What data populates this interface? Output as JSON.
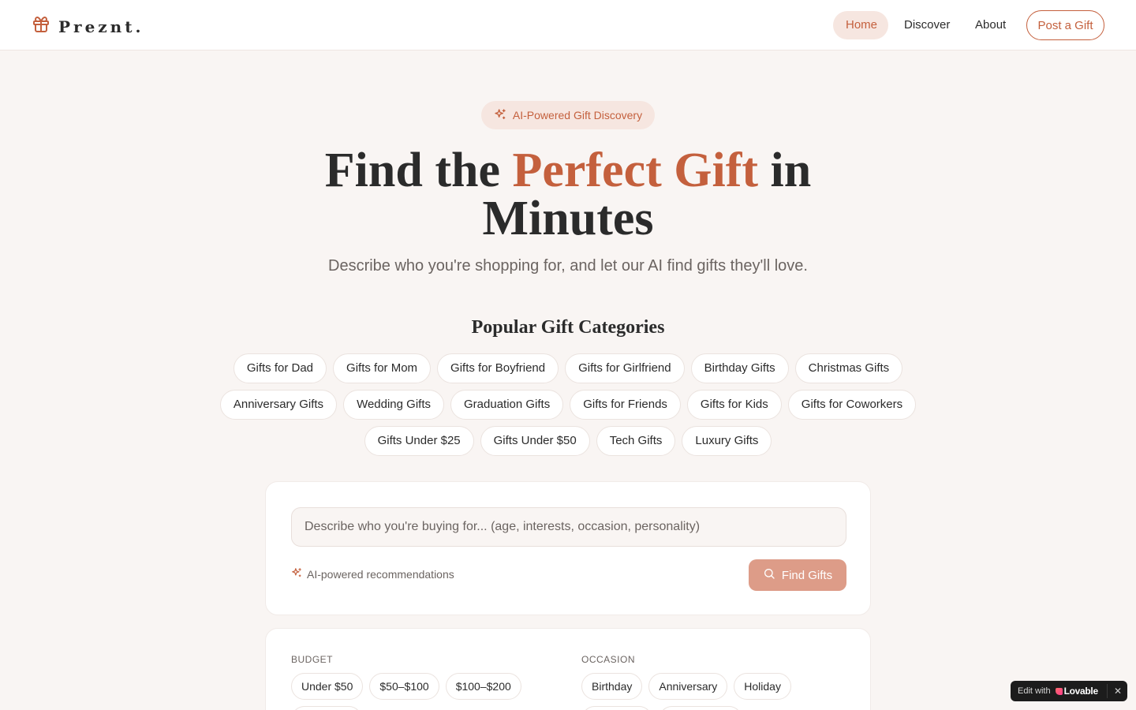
{
  "header": {
    "logo_text": "Preznt.",
    "nav": {
      "home": "Home",
      "discover": "Discover",
      "about": "About"
    },
    "post_button": "Post a Gift",
    "accent_color": "#c4603d"
  },
  "hero": {
    "badge": "AI-Powered Gift Discovery",
    "title_start": "Find the ",
    "title_accent": "Perfect Gift",
    "title_end": " in Minutes",
    "subtitle": "Describe who you're shopping for, and let our AI find gifts they'll love."
  },
  "categories": {
    "title": "Popular Gift Categories",
    "items": [
      "Gifts for Dad",
      "Gifts for Mom",
      "Gifts for Boyfriend",
      "Gifts for Girlfriend",
      "Birthday Gifts",
      "Christmas Gifts",
      "Anniversary Gifts",
      "Wedding Gifts",
      "Graduation Gifts",
      "Gifts for Friends",
      "Gifts for Kids",
      "Gifts for Coworkers",
      "Gifts Under $25",
      "Gifts Under $50",
      "Tech Gifts",
      "Luxury Gifts"
    ]
  },
  "search": {
    "placeholder": "Describe who you're buying for... (age, interests, occasion, personality)",
    "value": "",
    "ai_note": "AI-powered recommendations",
    "button": "Find Gifts"
  },
  "filters": {
    "budget_label": "BUDGET",
    "budget_options": [
      "Under $50",
      "$50–$100",
      "$100–$200"
    ],
    "occasion_label": "OCCASION",
    "occasion_options": [
      "Birthday",
      "Anniversary",
      "Holiday"
    ]
  },
  "lovable": {
    "edit_text": "Edit with",
    "brand": "Lovable",
    "close": "✕"
  },
  "icons": [
    "gift-icon",
    "sparkles-icon",
    "search-icon",
    "close-icon"
  ]
}
